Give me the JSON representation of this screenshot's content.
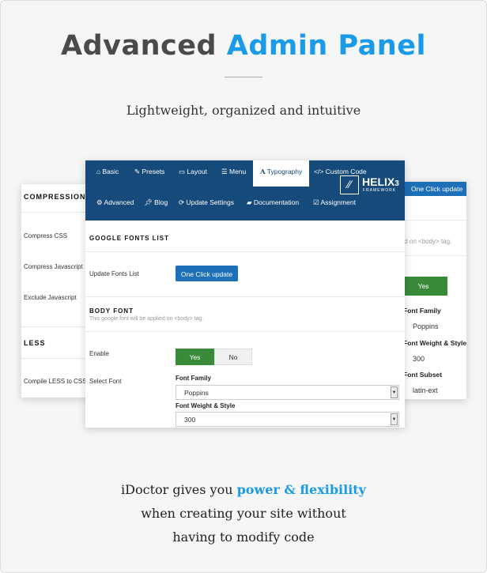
{
  "header": {
    "title_a": "Advanced",
    "title_b": "Admin Panel",
    "subtitle": "Lightweight, organized and intuitive"
  },
  "left_panel": {
    "section1": "COMPRESSION",
    "items": [
      "Compress CSS",
      "Compress Javascript",
      "Exclude Javascript"
    ],
    "section2": "LESS",
    "less_item": "Compile LESS to CSS"
  },
  "main_panel": {
    "tabs": [
      {
        "icon": "home-icon",
        "label": "Basic"
      },
      {
        "icon": "brush-icon",
        "label": "Presets"
      },
      {
        "icon": "layout-icon",
        "label": "Layout"
      },
      {
        "icon": "list-icon",
        "label": "Menu"
      },
      {
        "icon": "font-icon",
        "label": "Typography"
      },
      {
        "icon": "code-icon",
        "label": "Custom Code"
      },
      {
        "icon": "gear-icon",
        "label": "Advanced"
      },
      {
        "icon": "pin-icon",
        "label": "Blog"
      },
      {
        "icon": "refresh-icon",
        "label": "Update Settings"
      },
      {
        "icon": "book-icon",
        "label": "Documentation"
      },
      {
        "icon": "checkbox-icon",
        "label": "Assignment"
      }
    ],
    "active_tab": "Typography",
    "logo": {
      "name": "HELIX",
      "version": "3",
      "sub": "FRAMEWORK"
    },
    "google_fonts_title": "GOOGLE FONTS LIST",
    "update_fonts_label": "Update Fonts List",
    "update_button": "One Click update",
    "body_font_title": "BODY FONT",
    "body_font_desc": "This google font will be applied on <body> tag.",
    "enable_label": "Enable",
    "yes": "Yes",
    "no": "No",
    "select_font_label": "Select Font",
    "font_family_label": "Font Family",
    "font_family_value": "Poppins",
    "font_weight_label": "Font Weight & Style",
    "font_weight_value": "300"
  },
  "right_panel": {
    "button": "One Click update",
    "desc": "ied on <body> tag.",
    "yes": "Yes",
    "font_family_label": "Font Family",
    "font_family_value": "Poppins",
    "font_weight_label": "Font Weight & Style",
    "font_weight_value": "300",
    "subset_label": "Font Subset",
    "subset_value": "latin-ext"
  },
  "footer": {
    "line1_a": "iDoctor gives you ",
    "line1_b": "power & flexibility",
    "line2": "when creating your site without",
    "line3": "having to modify code"
  },
  "colors": {
    "accent": "#1a9be8",
    "nav": "#154a7b",
    "yes": "#3a8a3a"
  }
}
